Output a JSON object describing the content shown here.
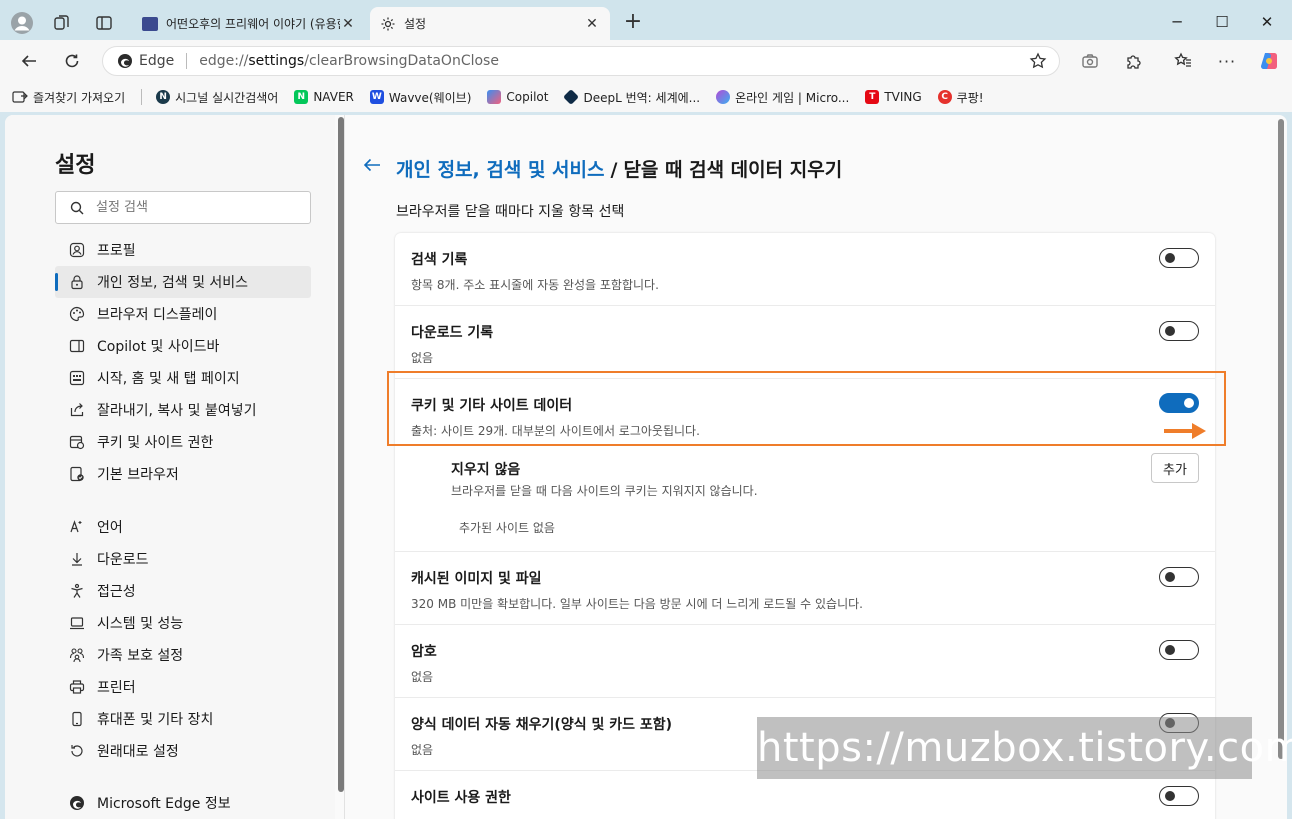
{
  "browser": {
    "tabs": [
      {
        "title": "어떤오후의 프리웨어 이야기 (유용한",
        "active": false
      },
      {
        "title": "설정",
        "active": true
      }
    ],
    "address": {
      "site_label": "Edge",
      "url_prefix": "edge://",
      "url_bold": "settings",
      "url_rest": "/clearBrowsingDataOnClose"
    },
    "bookmarks": [
      {
        "label": "즐겨찾기 가져오기",
        "icon": "import-favorites-icon",
        "color": "#555555"
      },
      {
        "label": "시그널 실시간검색어",
        "icon": "signal-icon",
        "color": "#1b3a4b"
      },
      {
        "label": "NAVER",
        "icon": "naver-icon",
        "color": "#03c75a"
      },
      {
        "label": "Wavve(웨이브)",
        "icon": "wavve-icon",
        "color": "#1f4fe0"
      },
      {
        "label": "Copilot",
        "icon": "copilot-icon",
        "color": "#7a5af8"
      },
      {
        "label": "DeepL 번역: 세계에...",
        "icon": "deepl-icon",
        "color": "#0f2b46"
      },
      {
        "label": "온라인 게임 | Micro...",
        "icon": "msn-games-icon",
        "color": "#b24bd6"
      },
      {
        "label": "TVING",
        "icon": "tving-icon",
        "color": "#e50914"
      },
      {
        "label": "쿠팡!",
        "icon": "coupang-icon",
        "color": "#e5322d"
      }
    ]
  },
  "sidebar": {
    "title": "설정",
    "search_placeholder": "설정 검색",
    "items": [
      {
        "label": "프로필",
        "icon": "profile-icon",
        "selected": false
      },
      {
        "label": "개인 정보, 검색 및 서비스",
        "icon": "lock-icon",
        "selected": true
      },
      {
        "label": "브라우저 디스플레이",
        "icon": "palette-icon",
        "selected": false
      },
      {
        "label": "Copilot 및 사이드바",
        "icon": "sidebar-icon",
        "selected": false
      },
      {
        "label": "시작, 홈 및 새 탭 페이지",
        "icon": "home-grid-icon",
        "selected": false
      },
      {
        "label": "잘라내기, 복사 및 붙여넣기",
        "icon": "share-icon",
        "selected": false
      },
      {
        "label": "쿠키 및 사이트 권한",
        "icon": "cookie-permissions-icon",
        "selected": false
      },
      {
        "label": "기본 브라우저",
        "icon": "default-browser-icon",
        "selected": false
      }
    ],
    "items2": [
      {
        "label": "언어",
        "icon": "language-icon"
      },
      {
        "label": "다운로드",
        "icon": "download-icon"
      },
      {
        "label": "접근성",
        "icon": "accessibility-icon"
      },
      {
        "label": "시스템 및 성능",
        "icon": "laptop-icon"
      },
      {
        "label": "가족 보호 설정",
        "icon": "family-icon"
      },
      {
        "label": "프린터",
        "icon": "printer-icon"
      },
      {
        "label": "휴대폰 및 기타 장치",
        "icon": "phone-icon"
      },
      {
        "label": "원래대로 설정",
        "icon": "reset-icon"
      }
    ],
    "about": {
      "label": "Microsoft Edge 정보",
      "icon": "edge-logo-icon"
    }
  },
  "main": {
    "breadcrumb_parent": "개인 정보, 검색 및 서비스",
    "breadcrumb_sep": "/",
    "breadcrumb_current": "닫을 때 검색 데이터 지우기",
    "subtitle": "브라우저를 닫을 때마다 지울 항목 선택",
    "options": [
      {
        "title": "검색 기록",
        "desc": "항목 8개. 주소 표시줄에 자동 완성을 포함합니다.",
        "on": false
      },
      {
        "title": "다운로드 기록",
        "desc": "없음",
        "on": false
      },
      {
        "title": "쿠키 및 기타 사이트 데이터",
        "desc": "출처: 사이트 29개. 대부분의 사이트에서 로그아웃됩니다.",
        "on": true
      },
      {
        "title": "캐시된 이미지 및 파일",
        "desc": "320 MB 미만을 확보합니다. 일부 사이트는 다음 방문 시에 더 느리게 로드될 수 있습니다.",
        "on": false
      },
      {
        "title": "암호",
        "desc": "없음",
        "on": false
      },
      {
        "title": "양식 데이터 자동 채우기(양식 및 카드 포함)",
        "desc": "없음",
        "on": false
      },
      {
        "title": "사이트 사용 권한",
        "desc": "",
        "on": false
      }
    ],
    "exception": {
      "title": "지우지 않음",
      "desc": "브라우저를 닫을 때 다음 사이트의 쿠키는 지워지지 않습니다.",
      "empty": "추가된 사이트 없음",
      "add_label": "추가"
    }
  },
  "colors": {
    "accent": "#0f6cbd",
    "highlight": "#ef7d2a"
  },
  "watermark": "https://muzbox.tistory.com"
}
